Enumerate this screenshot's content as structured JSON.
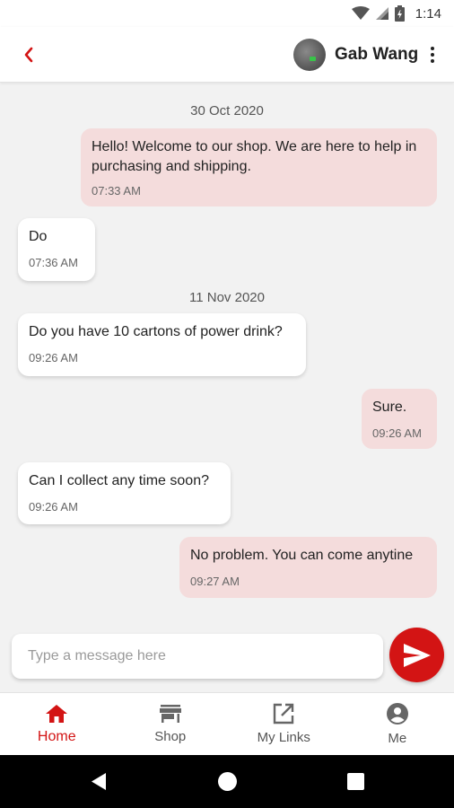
{
  "status_bar": {
    "time": "1:14",
    "icons": [
      "wifi-icon",
      "signal-icon",
      "battery-icon"
    ]
  },
  "header": {
    "back_icon": "chevron-left-icon",
    "contact_name": "Gab Wang",
    "more_icon": "more-vertical-icon"
  },
  "chat": {
    "separators": [
      "30 Oct 2020",
      "11 Nov 2020"
    ],
    "messages": [
      {
        "direction": "outgoing",
        "text": "Hello! Welcome to our shop. We are here to help in purchasing and shipping.",
        "time": "07:33 AM"
      },
      {
        "direction": "incoming",
        "text": "Do",
        "time": "07:36 AM"
      },
      {
        "direction": "incoming",
        "text": "Do you have 10 cartons of power drink?",
        "time": "09:26 AM"
      },
      {
        "direction": "outgoing",
        "text": "Sure.",
        "time": "09:26 AM"
      },
      {
        "direction": "incoming",
        "text": "Can I collect any time soon?",
        "time": "09:26 AM"
      },
      {
        "direction": "outgoing",
        "text": "No problem. You can come anytine",
        "time": "09:27 AM"
      }
    ]
  },
  "composer": {
    "placeholder": "Type a message here",
    "value": "",
    "send_icon": "send-icon"
  },
  "bottom_nav": {
    "items": [
      {
        "label": "Home",
        "icon": "home-icon",
        "active": true
      },
      {
        "label": "Shop",
        "icon": "store-icon",
        "active": false
      },
      {
        "label": "My Links",
        "icon": "external-link-icon",
        "active": false
      },
      {
        "label": "Me",
        "icon": "account-circle-icon",
        "active": false
      }
    ]
  },
  "colors": {
    "accent": "#d31414",
    "outgoing_bubble": "#f4dcdc",
    "incoming_bubble": "#ffffff",
    "background": "#f2f2f2"
  }
}
